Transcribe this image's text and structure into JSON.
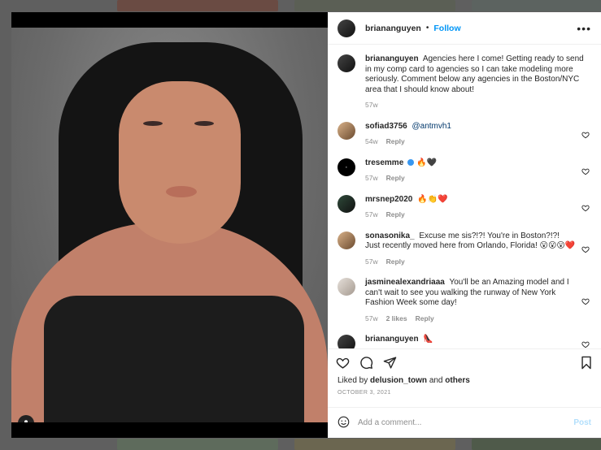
{
  "header": {
    "username": "briananguyen",
    "separator": "•",
    "follow": "Follow",
    "more": "•••"
  },
  "caption": {
    "username": "briananguyen",
    "text": "Agencies here I come! Getting ready to send in my comp card to agencies so I can take modeling more seriously. Comment below any agencies in the Boston/NYC area that I should know about!",
    "time": "57w"
  },
  "comments": [
    {
      "username": "sofiad3756",
      "text": "@antmvh1",
      "time": "54w",
      "likes": "",
      "reply": "Reply"
    },
    {
      "username": "tresemme",
      "text": "🔥🖤",
      "time": "57w",
      "likes": "",
      "reply": "Reply"
    },
    {
      "username": "mrsnep2020",
      "text": "🔥👏❤️",
      "time": "57w",
      "likes": "",
      "reply": "Reply"
    },
    {
      "username": "sonasonika_",
      "text": "Excuse me sis?!?! You're in Boston?!?! Just recently moved here from Orlando, Florida! 😮😮😮❤️",
      "time": "57w",
      "likes": "",
      "reply": "Reply"
    },
    {
      "username": "jasminealexandriaaa",
      "text": "You'll be an Amazing model and I can't wait to see you walking the runway of New York Fashion Week some day!",
      "time": "57w",
      "likes": "2 likes",
      "reply": "Reply"
    },
    {
      "username": "briananguyen",
      "text": "👠",
      "time": "",
      "likes": "",
      "reply": ""
    }
  ],
  "likes": {
    "prefix": "Liked by",
    "user": "delusion_town",
    "and": "and",
    "others": "others"
  },
  "date": "OCTOBER 3, 2021",
  "add_comment": {
    "placeholder": "Add a comment...",
    "post": "Post"
  },
  "icons": {
    "heart": "heart-icon",
    "comment": "comment-icon",
    "share": "share-icon",
    "save": "bookmark-icon",
    "emoji": "emoji-icon",
    "tagged_user": "user-tag-icon"
  },
  "colors": {
    "accent": "#0095f6",
    "post_disabled": "#b2dffc"
  }
}
